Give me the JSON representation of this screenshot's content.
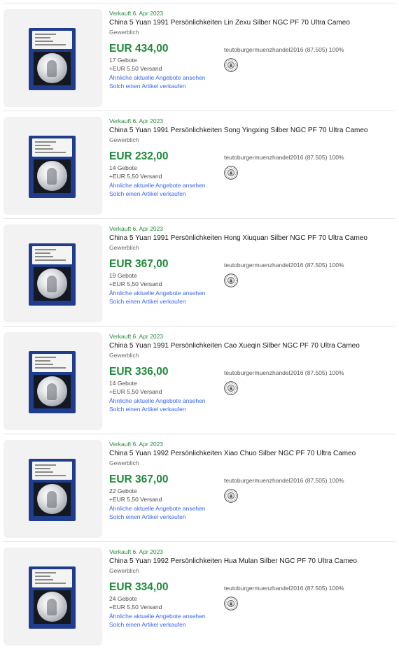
{
  "listings": [
    {
      "sold_date": "Verkauft 6. Apr 2023",
      "title": "China 5 Yuan 1991 Persönlichkeiten Lin Zexu Silber NGC PF 70 Ultra Cameo",
      "seller_type": "Gewerblich",
      "price": "EUR 434,00",
      "bids": "17 Gebote",
      "shipping": "+EUR 5,50 Versand",
      "similar_link": "Ähnliche aktuelle Angebote ansehen",
      "sell_link": "Solch einen Artikel verkaufen",
      "seller": "teutoburgermuenzhandel2016 (87.505) 100%",
      "seal_icon": "seller-seal-icon"
    },
    {
      "sold_date": "Verkauft 6. Apr 2023",
      "title": "China 5 Yuan 1991 Persönlichkeiten Song Yingxing Silber NGC PF 70 Ultra Cameo",
      "seller_type": "Gewerblich",
      "price": "EUR 232,00",
      "bids": "14 Gebote",
      "shipping": "+EUR 5,50 Versand",
      "similar_link": "Ähnliche aktuelle Angebote ansehen",
      "sell_link": "Solch einen Artikel verkaufen",
      "seller": "teutoburgermuenzhandel2016 (87.505) 100%",
      "seal_icon": "seller-seal-icon"
    },
    {
      "sold_date": "Verkauft 6. Apr 2023",
      "title": "China 5 Yuan 1991 Persönlichkeiten Hong Xiuquan Silber NGC PF 70 Ultra Cameo",
      "seller_type": "Gewerblich",
      "price": "EUR 367,00",
      "bids": "19 Gebote",
      "shipping": "+EUR 5,50 Versand",
      "similar_link": "Ähnliche aktuelle Angebote ansehen",
      "sell_link": "Solch einen Artikel verkaufen",
      "seller": "teutoburgermuenzhandel2016 (87.505) 100%",
      "seal_icon": "seller-seal-icon"
    },
    {
      "sold_date": "Verkauft 6. Apr 2023",
      "title": "China 5 Yuan 1991 Persönlichkeiten Cao Xueqin Silber NGC PF 70 Ultra Cameo",
      "seller_type": "Gewerblich",
      "price": "EUR 336,00",
      "bids": "14 Gebote",
      "shipping": "+EUR 5,50 Versand",
      "similar_link": "Ähnliche aktuelle Angebote ansehen",
      "sell_link": "Solch einen Artikel verkaufen",
      "seller": "teutoburgermuenzhandel2016 (87.505) 100%",
      "seal_icon": "seller-seal-icon"
    },
    {
      "sold_date": "Verkauft 6. Apr 2023",
      "title": "China 5 Yuan 1992 Persönlichkeiten Xiao Chuo Silber NGC PF 70 Ultra Cameo",
      "seller_type": "Gewerblich",
      "price": "EUR 367,00",
      "bids": "22 Gebote",
      "shipping": "+EUR 5,50 Versand",
      "similar_link": "Ähnliche aktuelle Angebote ansehen",
      "sell_link": "Solch einen Artikel verkaufen",
      "seller": "teutoburgermuenzhandel2016 (87.505) 100%",
      "seal_icon": "seller-seal-icon"
    },
    {
      "sold_date": "Verkauft 6. Apr 2023",
      "title": "China 5 Yuan 1992 Persönlichkeiten Hua Mulan Silber NGC PF 70 Ultra Cameo",
      "seller_type": "Gewerblich",
      "price": "EUR 334,00",
      "bids": "24 Gebote",
      "shipping": "+EUR 5,50 Versand",
      "similar_link": "Ähnliche aktuelle Angebote ansehen",
      "sell_link": "Solch einen Artikel verkaufen",
      "seller": "teutoburgermuenzhandel2016 (87.505) 100%",
      "seal_icon": "seller-seal-icon"
    }
  ]
}
